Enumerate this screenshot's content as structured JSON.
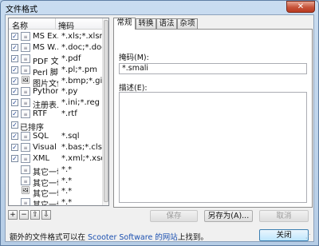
{
  "window": {
    "title": "文件格式",
    "close_label": "✕"
  },
  "list": {
    "headers": {
      "name": "名称",
      "mask": "掩码"
    },
    "rows": [
      {
        "checked": true,
        "icon": "lines",
        "name": "MS Ex...",
        "mask": "*.xls;*.xlsm;..."
      },
      {
        "checked": true,
        "icon": "lines",
        "name": "MS W...",
        "mask": "*.doc;*.doc..."
      },
      {
        "checked": true,
        "icon": "lines",
        "name": "PDF 文...",
        "mask": "*.pdf"
      },
      {
        "checked": true,
        "icon": "lines",
        "name": "Perl 脚...",
        "mask": "*.pl;*.pm"
      },
      {
        "checked": true,
        "icon": "image",
        "name": "图片文件",
        "mask": "*.bmp;*.gif;..."
      },
      {
        "checked": true,
        "icon": "lines",
        "name": "Python...",
        "mask": "*.py"
      },
      {
        "checked": true,
        "icon": "lines",
        "name": "注册表...",
        "mask": "*.ini;*.reg"
      },
      {
        "checked": true,
        "icon": "lines",
        "name": "RTF",
        "mask": "*.rtf"
      },
      {
        "checked": true,
        "icon": "none",
        "name": "已排序",
        "mask": ""
      },
      {
        "checked": true,
        "icon": "lines",
        "name": "SQL",
        "mask": "*.sql"
      },
      {
        "checked": true,
        "icon": "lines",
        "name": "Visual ...",
        "mask": "*.bas;*.cls;*..."
      },
      {
        "checked": true,
        "icon": "lines",
        "name": "XML",
        "mask": "*.xml;*.xsd;..."
      },
      {
        "checked": false,
        "icon": "lines",
        "name": "其它一切",
        "mask": "*.*"
      },
      {
        "checked": false,
        "icon": "lines",
        "name": "其它一切",
        "mask": "*.*"
      },
      {
        "checked": false,
        "icon": "image",
        "name": "其它一切",
        "mask": "*.*"
      },
      {
        "checked": false,
        "icon": "lines",
        "name": "其它一切",
        "mask": "*.*"
      }
    ],
    "check_glyph": "✓"
  },
  "mini_buttons": [
    "+",
    "−",
    "⇧",
    "⇩"
  ],
  "tabs": [
    "常规",
    "转换",
    "语法",
    "杂项"
  ],
  "general": {
    "mask_label": "掩码(M):",
    "mask_value": "*.smali",
    "desc_label": "描述(E):",
    "desc_value": ""
  },
  "buttons": {
    "save": "保存",
    "save_as": "另存为(A)...",
    "cancel": "取消",
    "close": "关闭"
  },
  "footer": {
    "prefix": "额外的文件格式可以在 ",
    "link": "Scooter Software 的网站",
    "suffix": "上找到。"
  }
}
